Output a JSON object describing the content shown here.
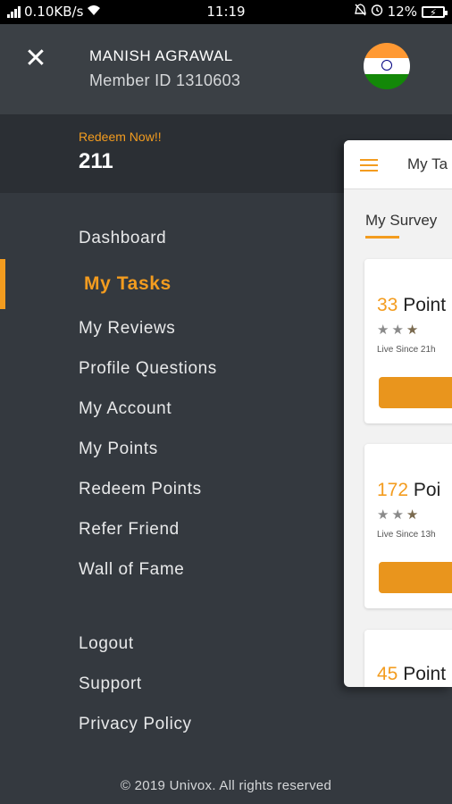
{
  "status_bar": {
    "speed": "0.10KB/s",
    "time": "11:19",
    "battery": "12%",
    "icons": [
      "signal-icon",
      "wifi-icon",
      "mute-icon",
      "alarm-icon",
      "battery-charging-icon"
    ]
  },
  "profile": {
    "name": "MANISH AGRAWAL",
    "member_id": "Member ID 1310603",
    "flag": "india-flag"
  },
  "redeem": {
    "label": "Redeem Now!!",
    "points": "211"
  },
  "menu": {
    "items": [
      {
        "label": "Dashboard"
      },
      {
        "label": "My Tasks"
      },
      {
        "label": "My Reviews"
      },
      {
        "label": "Profile Questions"
      },
      {
        "label": "My Account"
      },
      {
        "label": "My Points"
      },
      {
        "label": "Redeem Points"
      },
      {
        "label": "Refer Friend"
      },
      {
        "label": "Wall of Fame"
      }
    ],
    "secondary": [
      {
        "label": "Logout"
      },
      {
        "label": "Support"
      },
      {
        "label": "Privacy Policy"
      }
    ]
  },
  "footer": "© 2019 Univox. All rights reserved",
  "background_screen": {
    "title": "My Ta",
    "tab": "My Survey",
    "surveys": [
      {
        "points": "33",
        "label": "Point",
        "live": "Live Since 21h"
      },
      {
        "points": "172",
        "label": "Poi",
        "live": "Live Since 13h"
      },
      {
        "points": "45",
        "label": "Point"
      }
    ]
  },
  "colors": {
    "accent": "#f39c1f",
    "drawer_bg": "#34393f",
    "header_bg": "#3b4045",
    "band_bg": "#2b2f34"
  }
}
